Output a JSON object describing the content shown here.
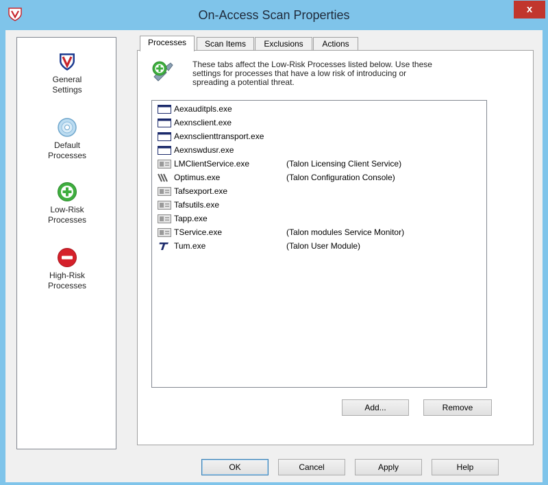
{
  "window": {
    "title": "On-Access Scan Properties",
    "close_label": "x"
  },
  "sidebar": {
    "items": [
      {
        "label_line1": "General",
        "label_line2": "Settings",
        "icon": "shield-icon"
      },
      {
        "label_line1": "Default",
        "label_line2": "Processes",
        "icon": "disc-icon"
      },
      {
        "label_line1": "Low-Risk",
        "label_line2": "Processes",
        "icon": "plus-circle-icon"
      },
      {
        "label_line1": "High-Risk",
        "label_line2": "Processes",
        "icon": "minus-circle-icon"
      }
    ]
  },
  "tabs": [
    {
      "label": "Processes",
      "active": true
    },
    {
      "label": "Scan Items",
      "active": false
    },
    {
      "label": "Exclusions",
      "active": false
    },
    {
      "label": "Actions",
      "active": false
    }
  ],
  "info": {
    "line1": "These tabs affect the Low-Risk Processes listed below.  Use these",
    "line2": "settings for processes that have a low risk of introducing or",
    "line3": "spreading a potential threat."
  },
  "processes": [
    {
      "name": "Aexauditpls.exe",
      "desc": "",
      "icon": "window-icon"
    },
    {
      "name": "Aexnsclient.exe",
      "desc": "",
      "icon": "window-icon"
    },
    {
      "name": "Aexnsclienttransport.exe",
      "desc": "",
      "icon": "window-icon"
    },
    {
      "name": "Aexnswdusr.exe",
      "desc": "",
      "icon": "window-icon"
    },
    {
      "name": "LMClientService.exe",
      "desc": "(Talon Licensing Client Service)",
      "icon": "service-icon"
    },
    {
      "name": "Optimus.exe",
      "desc": "(Talon Configuration Console)",
      "icon": "optimus-icon"
    },
    {
      "name": "Tafsexport.exe",
      "desc": "",
      "icon": "service-icon"
    },
    {
      "name": "Tafsutils.exe",
      "desc": "",
      "icon": "service-icon"
    },
    {
      "name": "Tapp.exe",
      "desc": "",
      "icon": "service-icon"
    },
    {
      "name": "TService.exe",
      "desc": "(Talon modules Service Monitor)",
      "icon": "service-icon"
    },
    {
      "name": "Tum.exe",
      "desc": "(Talon User Module)",
      "icon": "talon-t-icon"
    }
  ],
  "list_buttons": {
    "add": "Add...",
    "remove": "Remove"
  },
  "dialog_buttons": {
    "ok": "OK",
    "cancel": "Cancel",
    "apply": "Apply",
    "help": "Help"
  },
  "colors": {
    "titlebar": "#7fc4ea",
    "close": "#c1362d",
    "shield": "#1b3a8f",
    "shield_v": "#c8262c",
    "green": "#3fae3f",
    "red": "#d5202a"
  }
}
